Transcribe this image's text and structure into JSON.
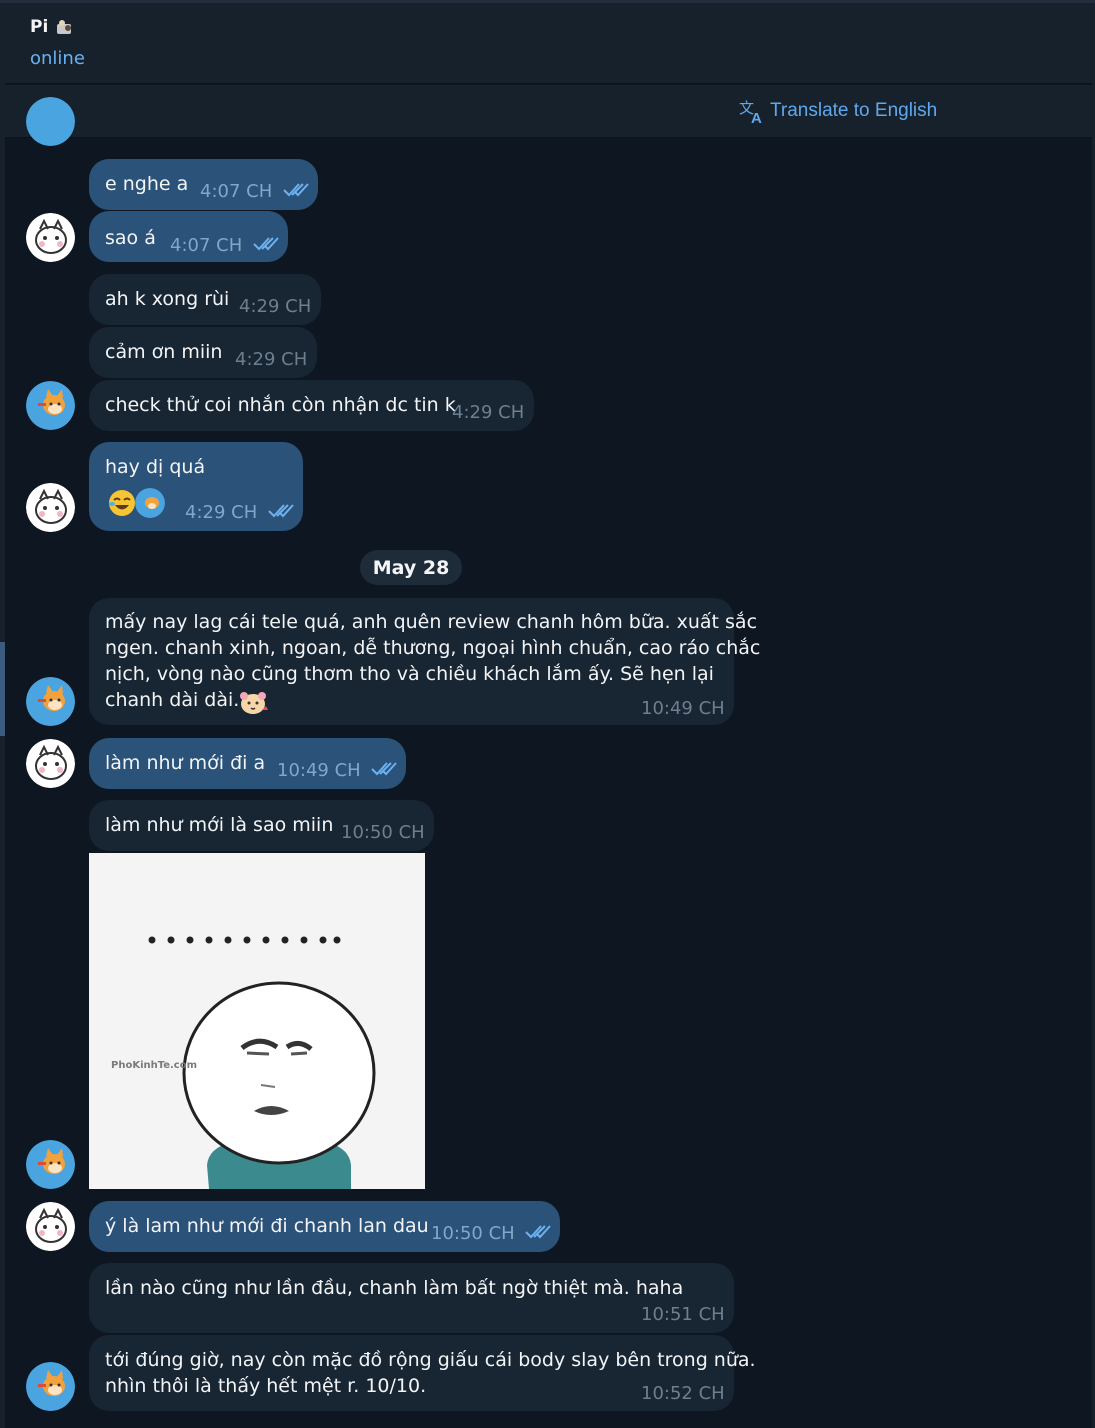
{
  "header": {
    "title": "Pi",
    "status": "online"
  },
  "translate": {
    "label": "Translate to English"
  },
  "date_divider": "May 28",
  "messages": [
    {
      "text": "e nghe a",
      "time": "4:07 CH"
    },
    {
      "text": "sao á",
      "time": "4:07 CH"
    },
    {
      "text": "ah k xong rùi",
      "time": "4:29 CH"
    },
    {
      "text": "cảm ơn miin",
      "time": "4:29 CH"
    },
    {
      "text": "check thử coi nhắn còn nhận dc tin k",
      "time": "4:29 CH"
    },
    {
      "text": "hay dị quá",
      "time": "4:29 CH"
    },
    {
      "line1": "mấy nay lag cái tele quá, anh quên review chanh hôm bữa. xuất sắc",
      "line2": "ngen. chanh xinh, ngoan, dễ thương, ngoại hình chuẩn, cao ráo chắc",
      "line3": "nịch, vòng nào cũng thơm tho và chiều khách lắm ấy. Sẽ hẹn lại",
      "line4": "chanh dài dài.",
      "time": "10:49 CH"
    },
    {
      "text": "làm như mới đi a",
      "time": "10:49 CH"
    },
    {
      "text": "làm như mới là sao miin",
      "time": "10:50 CH"
    },
    {
      "text": "ý là lam như mới đi chanh lan dau",
      "time": "10:50 CH"
    },
    {
      "text": "lần nào cũng như lần đầu, chanh làm bất ngờ thiệt mà. haha",
      "time": "10:51 CH"
    },
    {
      "line1": "tới đúng giờ, nay còn mặc đồ rộng giấu cái body slay bên trong nữa.",
      "line2": "nhìn thôi là thấy hết mệt r. 10/10.",
      "time": "10:52 CH"
    }
  ],
  "photo": {
    "watermark": "PhoKinhTe.com",
    "dots": "..........."
  },
  "colors": {
    "background": "#0e1621",
    "outgoing_bubble": "#2b5278",
    "incoming_bubble": "#182533",
    "accent": "#6ab2f2"
  },
  "icons": [
    "translate-icon",
    "double-check-icon",
    "avatar-sticker",
    "avatar-fox"
  ]
}
